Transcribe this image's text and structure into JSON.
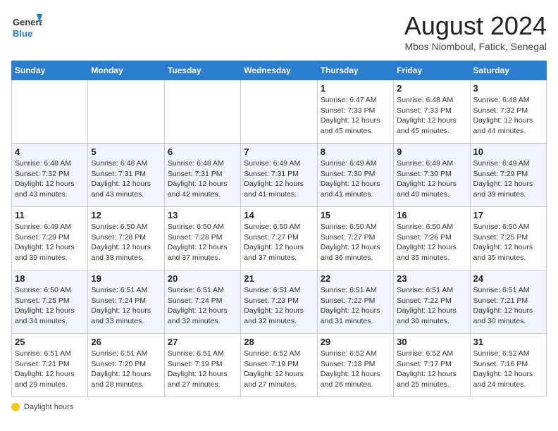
{
  "header": {
    "logo_line1": "General",
    "logo_line2": "Blue",
    "month_year": "August 2024",
    "location": "Mbos Niomboul, Fatick, Senegal"
  },
  "days_of_week": [
    "Sunday",
    "Monday",
    "Tuesday",
    "Wednesday",
    "Thursday",
    "Friday",
    "Saturday"
  ],
  "footer": {
    "daylight_hours_label": "Daylight hours"
  },
  "weeks": [
    [
      {
        "day": "",
        "info": ""
      },
      {
        "day": "",
        "info": ""
      },
      {
        "day": "",
        "info": ""
      },
      {
        "day": "",
        "info": ""
      },
      {
        "day": "1",
        "info": "Sunrise: 6:47 AM\nSunset: 7:33 PM\nDaylight: 12 hours\nand 45 minutes."
      },
      {
        "day": "2",
        "info": "Sunrise: 6:48 AM\nSunset: 7:33 PM\nDaylight: 12 hours\nand 45 minutes."
      },
      {
        "day": "3",
        "info": "Sunrise: 6:48 AM\nSunset: 7:32 PM\nDaylight: 12 hours\nand 44 minutes."
      }
    ],
    [
      {
        "day": "4",
        "info": "Sunrise: 6:48 AM\nSunset: 7:32 PM\nDaylight: 12 hours\nand 43 minutes."
      },
      {
        "day": "5",
        "info": "Sunrise: 6:48 AM\nSunset: 7:31 PM\nDaylight: 12 hours\nand 43 minutes."
      },
      {
        "day": "6",
        "info": "Sunrise: 6:48 AM\nSunset: 7:31 PM\nDaylight: 12 hours\nand 42 minutes."
      },
      {
        "day": "7",
        "info": "Sunrise: 6:49 AM\nSunset: 7:31 PM\nDaylight: 12 hours\nand 41 minutes."
      },
      {
        "day": "8",
        "info": "Sunrise: 6:49 AM\nSunset: 7:30 PM\nDaylight: 12 hours\nand 41 minutes."
      },
      {
        "day": "9",
        "info": "Sunrise: 6:49 AM\nSunset: 7:30 PM\nDaylight: 12 hours\nand 40 minutes."
      },
      {
        "day": "10",
        "info": "Sunrise: 6:49 AM\nSunset: 7:29 PM\nDaylight: 12 hours\nand 39 minutes."
      }
    ],
    [
      {
        "day": "11",
        "info": "Sunrise: 6:49 AM\nSunset: 7:29 PM\nDaylight: 12 hours\nand 39 minutes."
      },
      {
        "day": "12",
        "info": "Sunrise: 6:50 AM\nSunset: 7:28 PM\nDaylight: 12 hours\nand 38 minutes."
      },
      {
        "day": "13",
        "info": "Sunrise: 6:50 AM\nSunset: 7:28 PM\nDaylight: 12 hours\nand 37 minutes."
      },
      {
        "day": "14",
        "info": "Sunrise: 6:50 AM\nSunset: 7:27 PM\nDaylight: 12 hours\nand 37 minutes."
      },
      {
        "day": "15",
        "info": "Sunrise: 6:50 AM\nSunset: 7:27 PM\nDaylight: 12 hours\nand 36 minutes."
      },
      {
        "day": "16",
        "info": "Sunrise: 6:50 AM\nSunset: 7:26 PM\nDaylight: 12 hours\nand 35 minutes."
      },
      {
        "day": "17",
        "info": "Sunrise: 6:50 AM\nSunset: 7:25 PM\nDaylight: 12 hours\nand 35 minutes."
      }
    ],
    [
      {
        "day": "18",
        "info": "Sunrise: 6:50 AM\nSunset: 7:25 PM\nDaylight: 12 hours\nand 34 minutes."
      },
      {
        "day": "19",
        "info": "Sunrise: 6:51 AM\nSunset: 7:24 PM\nDaylight: 12 hours\nand 33 minutes."
      },
      {
        "day": "20",
        "info": "Sunrise: 6:51 AM\nSunset: 7:24 PM\nDaylight: 12 hours\nand 32 minutes."
      },
      {
        "day": "21",
        "info": "Sunrise: 6:51 AM\nSunset: 7:23 PM\nDaylight: 12 hours\nand 32 minutes."
      },
      {
        "day": "22",
        "info": "Sunrise: 6:51 AM\nSunset: 7:22 PM\nDaylight: 12 hours\nand 31 minutes."
      },
      {
        "day": "23",
        "info": "Sunrise: 6:51 AM\nSunset: 7:22 PM\nDaylight: 12 hours\nand 30 minutes."
      },
      {
        "day": "24",
        "info": "Sunrise: 6:51 AM\nSunset: 7:21 PM\nDaylight: 12 hours\nand 30 minutes."
      }
    ],
    [
      {
        "day": "25",
        "info": "Sunrise: 6:51 AM\nSunset: 7:21 PM\nDaylight: 12 hours\nand 29 minutes."
      },
      {
        "day": "26",
        "info": "Sunrise: 6:51 AM\nSunset: 7:20 PM\nDaylight: 12 hours\nand 28 minutes."
      },
      {
        "day": "27",
        "info": "Sunrise: 6:51 AM\nSunset: 7:19 PM\nDaylight: 12 hours\nand 27 minutes."
      },
      {
        "day": "28",
        "info": "Sunrise: 6:52 AM\nSunset: 7:19 PM\nDaylight: 12 hours\nand 27 minutes."
      },
      {
        "day": "29",
        "info": "Sunrise: 6:52 AM\nSunset: 7:18 PM\nDaylight: 12 hours\nand 26 minutes."
      },
      {
        "day": "30",
        "info": "Sunrise: 6:52 AM\nSunset: 7:17 PM\nDaylight: 12 hours\nand 25 minutes."
      },
      {
        "day": "31",
        "info": "Sunrise: 6:52 AM\nSunset: 7:16 PM\nDaylight: 12 hours\nand 24 minutes."
      }
    ]
  ]
}
